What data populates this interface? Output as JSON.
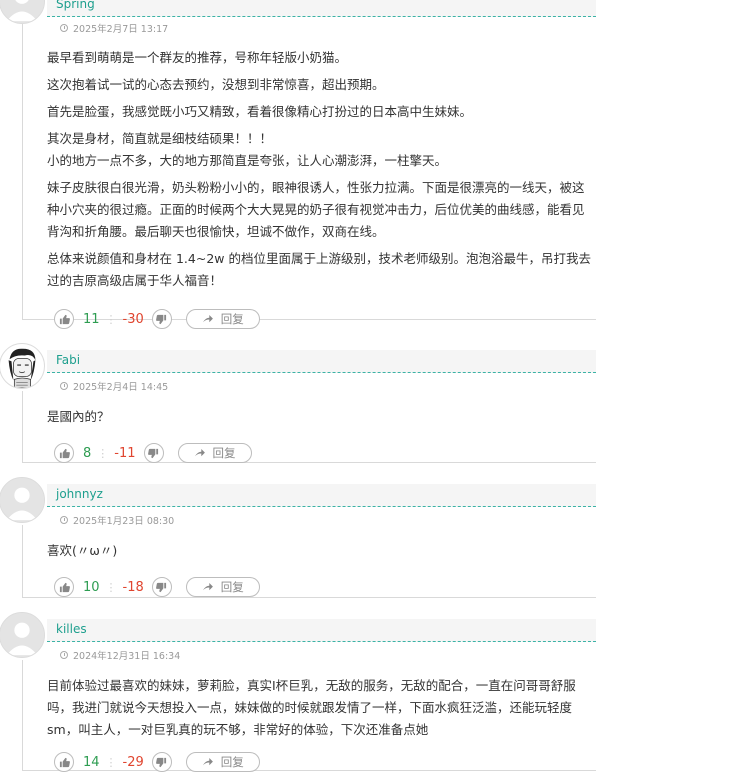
{
  "comments": [
    {
      "name": "Spring",
      "time": "2025年2月7日 13:17",
      "paragraphs": [
        "最早看到萌萌是一个群友的推荐，号称年轻版小奶猫。",
        "这次抱着试一试的心态去预约，没想到非常惊喜，超出预期。",
        "首先是脸蛋，我感觉既小巧又精致，看着很像精心打扮过的日本高中生妹妹。",
        "其次是身材，简直就是细枝结硕果！！！\n小的地方一点不多，大的地方那简直是夸张，让人心潮澎湃，一柱擎天。",
        "妹子皮肤很白很光滑，奶头粉粉小小的，眼神很诱人，性张力拉满。下面是很漂亮的一线天，被这种小穴夹的很过瘾。正面的时候两个大大晃晃的奶子很有视觉冲击力，后位优美的曲线感，能看见背沟和折角腰。最后聊天也很愉快，坦诚不做作，双商在线。",
        "总体来说颜值和身材在 1.4~2w 的档位里面属于上游级别，技术老师级别。泡泡浴最牛，吊打我去过的吉原高级店属于华人福音！"
      ],
      "up": "11",
      "down": "-30",
      "reply": "回复"
    },
    {
      "name": "Fabi",
      "time": "2025年2月4日 14:45",
      "paragraphs": [
        "是國內的？"
      ],
      "up": "8",
      "down": "-11",
      "reply": "回复"
    },
    {
      "name": "johnnyz",
      "time": "2025年1月23日 08:30",
      "paragraphs": [
        "喜欢(〃ω〃)"
      ],
      "up": "10",
      "down": "-18",
      "reply": "回复"
    },
    {
      "name": "killes",
      "time": "2024年12月31日 16:34",
      "paragraphs": [
        "目前体验过最喜欢的妹妹，萝莉脸，真实I杯巨乳，无敌的服务，无敌的配合，一直在问哥哥舒服吗，我进门就说今天想投入一点，妹妹做的时候就跟发情了一样，下面水疯狂泛滥，还能玩轻度sm，叫主人，一对巨乳真的玩不够，非常好的体验，下次还准备点她"
      ],
      "up": "14",
      "down": "-29",
      "reply": "回复"
    }
  ]
}
